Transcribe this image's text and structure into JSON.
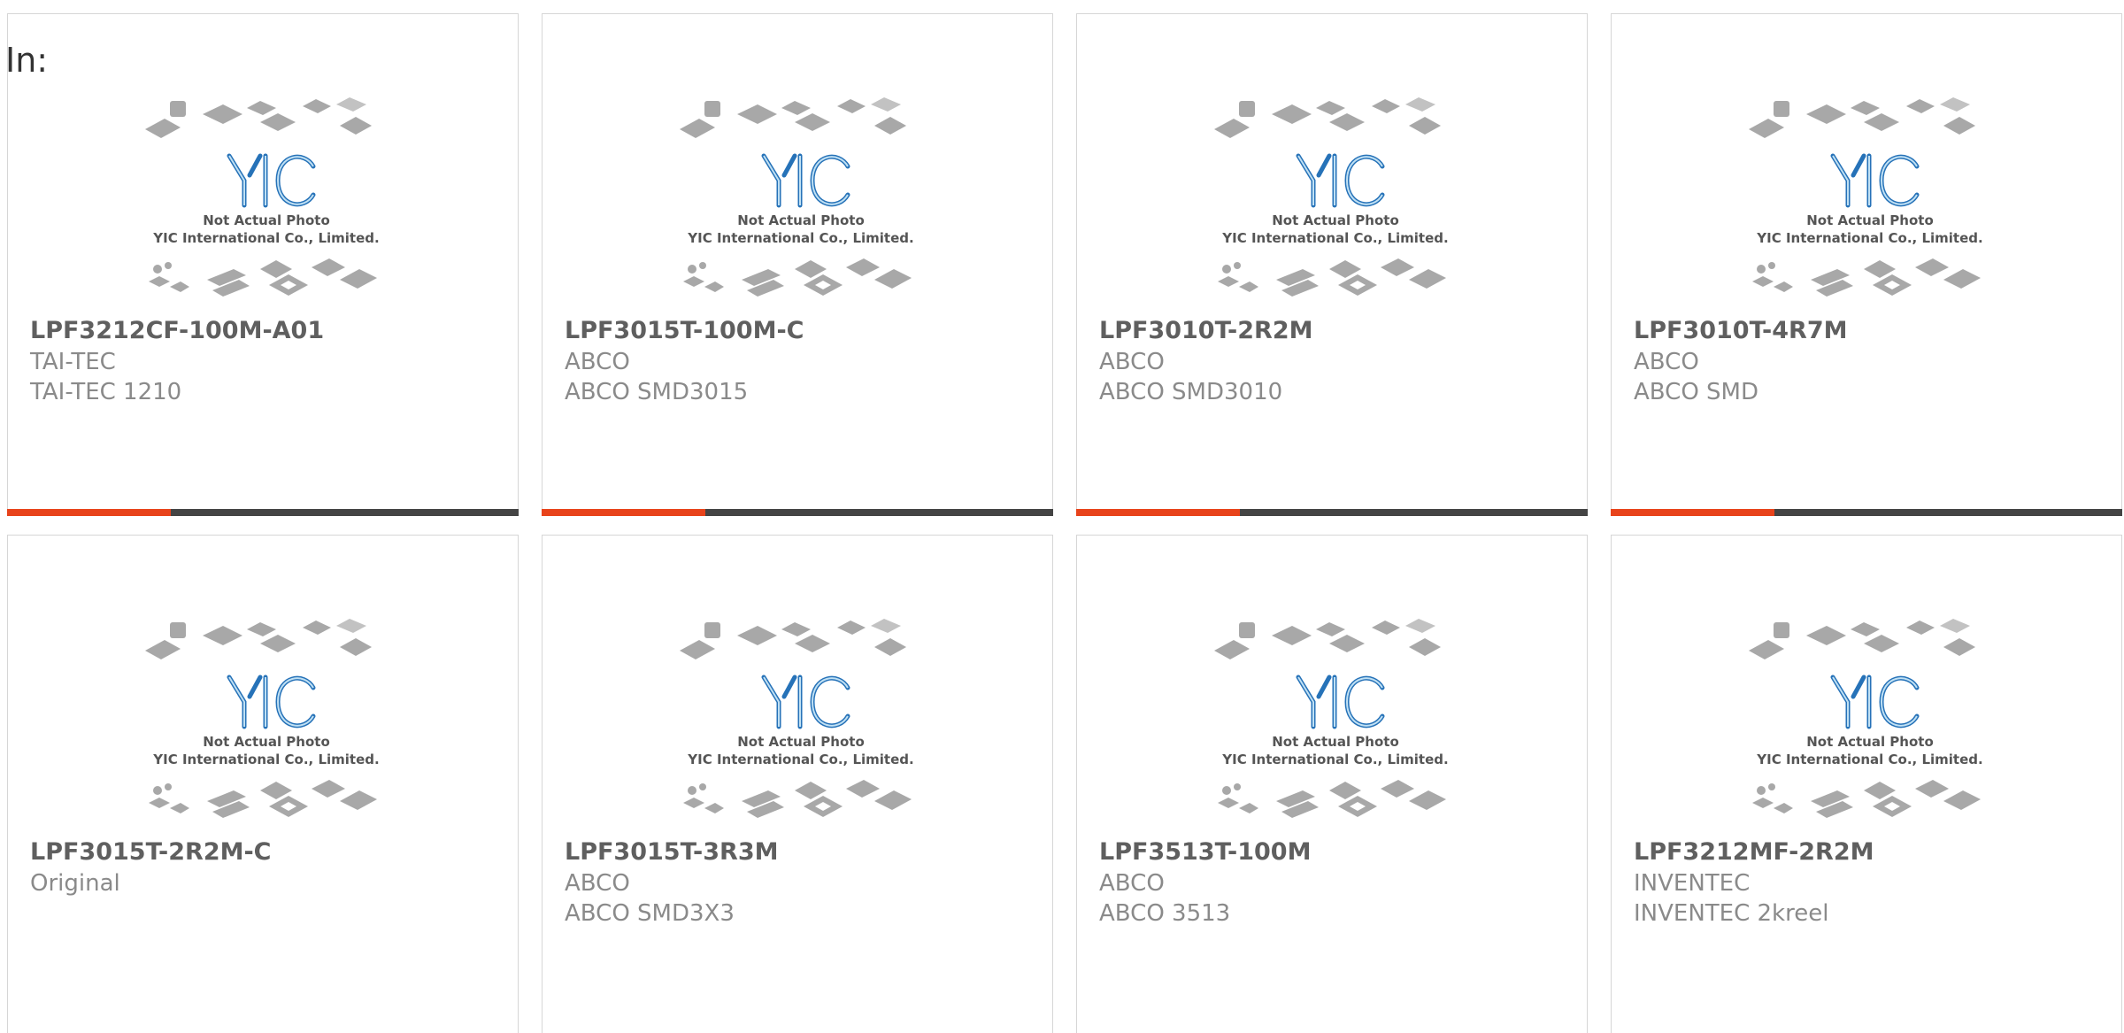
{
  "prefix_label": "In:",
  "colors": {
    "accent": "#e8431b",
    "bar_track": "#444444",
    "card_border": "#d6d6d6",
    "logo_blue": "#1f6fb5"
  },
  "placeholder_image": {
    "line1": "Not Actual Photo",
    "line2": "YIC International Co., Limited.",
    "logo_text": "YIC"
  },
  "products": [
    {
      "part_number": "LPF3212CF-100M-A01",
      "manufacturer": "TAI-TEC",
      "package": "TAI-TEC 1210",
      "progress": 0.32
    },
    {
      "part_number": "LPF3015T-100M-C",
      "manufacturer": "ABCO",
      "package": "ABCO SMD3015",
      "progress": 0.32
    },
    {
      "part_number": "LPF3010T-2R2M",
      "manufacturer": "ABCO",
      "package": "ABCO SMD3010",
      "progress": 0.32
    },
    {
      "part_number": "LPF3010T-4R7M",
      "manufacturer": "ABCO",
      "package": "ABCO SMD",
      "progress": 0.32
    },
    {
      "part_number": "LPF3015T-2R2M-C",
      "manufacturer": "Original",
      "package": "",
      "progress": null
    },
    {
      "part_number": "LPF3015T-3R3M",
      "manufacturer": "ABCO",
      "package": "ABCO SMD3X3",
      "progress": null
    },
    {
      "part_number": "LPF3513T-100M",
      "manufacturer": "ABCO",
      "package": "ABCO 3513",
      "progress": null
    },
    {
      "part_number": "LPF3212MF-2R2M",
      "manufacturer": "INVENTEC",
      "package": "INVENTEC 2kreel",
      "progress": null
    }
  ]
}
